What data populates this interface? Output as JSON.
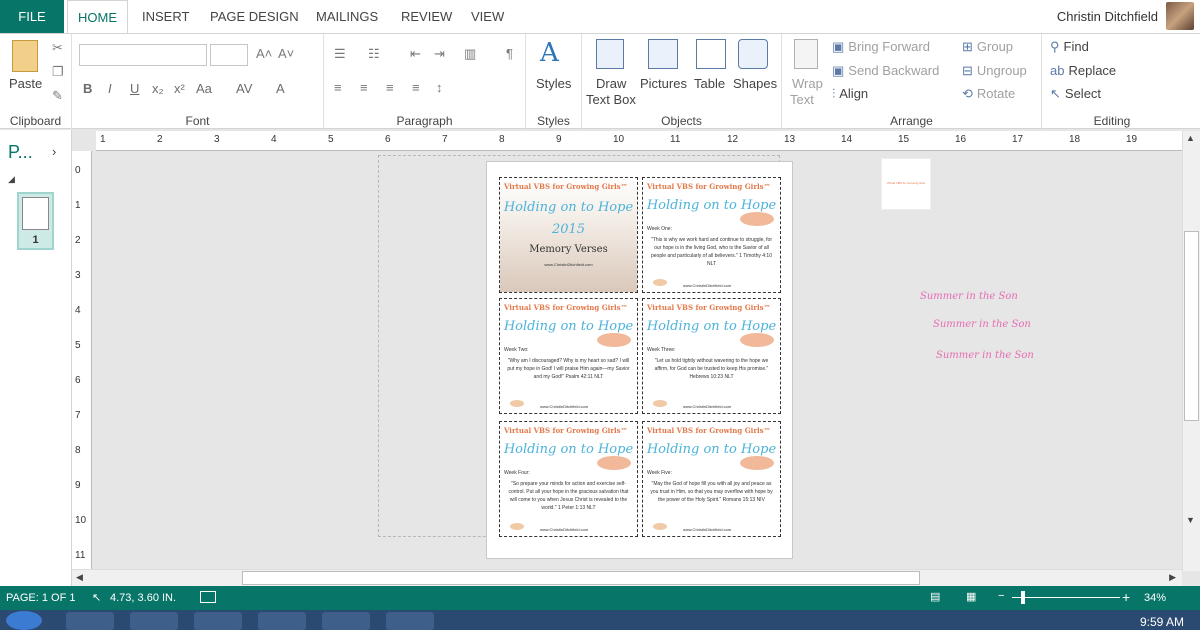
{
  "tabs": {
    "file": "FILE",
    "items": [
      "HOME",
      "INSERT",
      "PAGE DESIGN",
      "MAILINGS",
      "REVIEW",
      "VIEW"
    ],
    "active": "HOME"
  },
  "user": {
    "name": "Christin Ditchfield"
  },
  "ribbon": {
    "clipboard": {
      "label": "Clipboard",
      "paste": "Paste"
    },
    "font": {
      "label": "Font",
      "bold": "B",
      "italic": "I",
      "underline": "U",
      "sub": "x₂",
      "sup": "x²",
      "case": "Aa",
      "spacing": "AV",
      "color": "A",
      "grow": "A˄",
      "shrink": "A˅"
    },
    "paragraph": {
      "label": "Paragraph",
      "mark": "¶"
    },
    "styles": {
      "label": "Styles",
      "btn": "Styles"
    },
    "objects": {
      "label": "Objects",
      "draw_text_box": "Draw\nText Box",
      "draw1": "Draw",
      "draw2": "Text Box",
      "pictures": "Pictures",
      "table": "Table",
      "shapes": "Shapes"
    },
    "arrange": {
      "label": "Arrange",
      "wrap1": "Wrap",
      "wrap2": "Text",
      "bring_forward": "Bring Forward",
      "send_backward": "Send Backward",
      "align": "Align",
      "group": "Group",
      "ungroup": "Ungroup",
      "rotate": "Rotate"
    },
    "editing": {
      "label": "Editing",
      "find": "Find",
      "replace": "Replace",
      "select": "Select"
    }
  },
  "pages_panel": {
    "title": "P...",
    "page_num": "1"
  },
  "ruler": {
    "h": [
      "1",
      "2",
      "3",
      "4",
      "5",
      "6",
      "7",
      "8",
      "9",
      "10",
      "11",
      "12",
      "13",
      "14",
      "15",
      "16",
      "17",
      "18",
      "19"
    ],
    "v": [
      "0",
      "1",
      "2",
      "3",
      "4",
      "5",
      "6",
      "7",
      "8",
      "9",
      "10",
      "11"
    ]
  },
  "cards": {
    "brand": "Virtual VBS for Growing Girls™",
    "title": "Holding on to Hope",
    "site": "www.ChristinDitchfield.com",
    "cover": {
      "year": "2015",
      "subtitle": "Memory Verses",
      "site": "www.ChristinDitchfield.com"
    },
    "items": [
      {
        "week": "Week One:",
        "verse": "\"This is why we work hard and continue to struggle, for our hope is in the living God, who is the Savior of all people and particularly of all believers.\" 1 Timothy 4:10 NLT"
      },
      {
        "week": "Week Two:",
        "verse": "\"Why am I discouraged? Why is my heart so sad? I will put my hope in God! I will praise Him again—my Savior and my God!\" Psalm 42:11 NLT"
      },
      {
        "week": "Week Three:",
        "verse": "\"Let us hold tightly without wavering to the hope we affirm, for God can be trusted to keep His promise.\" Hebrews 10:23 NLT"
      },
      {
        "week": "Week Four:",
        "verse": "\"So prepare your minds for action and exercise self-control. Put all your hope in the gracious salvation that will come to you when Jesus Christ is revealed to the world.\" 1 Peter 1:13 NLT"
      },
      {
        "week": "Week Five:",
        "verse": "\"May the God of hope fill you with all joy and peace as you trust in Him, so that you may overflow with hope by the power of the Holy Spirit.\" Romans 15:13 NIV"
      }
    ]
  },
  "scratch": {
    "summer": "Summer in the Son",
    "smallpic": "Virtual VBS for Growing Girls"
  },
  "status": {
    "page": "PAGE: 1 OF 1",
    "pos": "4.73, 3.60 IN.",
    "zoom": "34%",
    "minus": "−",
    "plus": "+"
  },
  "taskbar": {
    "time": "9:59 AM"
  }
}
